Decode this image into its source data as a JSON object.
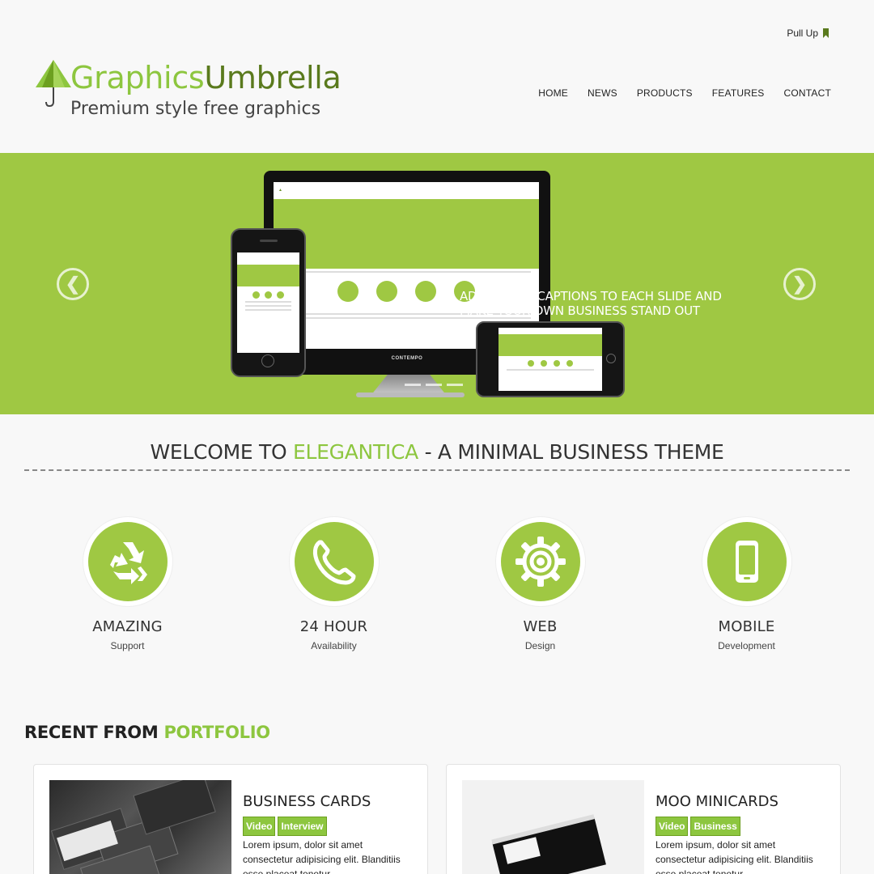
{
  "brand": {
    "name_part1": "Graphics",
    "name_part2": "Umbrella",
    "tagline": "Premium style free graphics"
  },
  "pull_up": {
    "label": "Pull Up"
  },
  "nav": {
    "items": [
      {
        "label": "HOME"
      },
      {
        "label": "NEWS"
      },
      {
        "label": "PRODUCTS"
      },
      {
        "label": "FEATURES"
      },
      {
        "label": "CONTACT"
      }
    ]
  },
  "hero": {
    "caption_line1": "ADD LOVELY CAPTIONS TO EACH SLIDE AND",
    "caption_line2": "MAKE YOUR OWN BUSINESS STAND OUT",
    "monitor_brand": "CONTEMPO"
  },
  "welcome": {
    "prefix": "WELCOME TO ",
    "accent": "ELEGANTICA",
    "suffix": " - A MINIMAL BUSINESS THEME"
  },
  "features": [
    {
      "title": "AMAZING",
      "subtitle": "Support",
      "icon": "recycle-icon"
    },
    {
      "title": "24 HOUR",
      "subtitle": "Availability",
      "icon": "phone-icon"
    },
    {
      "title": "WEB",
      "subtitle": "Design",
      "icon": "gear-icon"
    },
    {
      "title": "MOBILE",
      "subtitle": "Development",
      "icon": "mobile-icon"
    }
  ],
  "portfolio": {
    "heading_prefix": "RECENT FROM ",
    "heading_accent": "PORTFOLIO",
    "items": [
      {
        "title": "BUSINESS CARDS",
        "tags": [
          "Video",
          "Interview"
        ],
        "text": "Lorem ipsum, dolor sit amet consectetur adipisicing elit. Blanditiis esse placeat tenetur"
      },
      {
        "title": "MOO MINICARDS",
        "tags": [
          "Video",
          "Business"
        ],
        "text": "Lorem ipsum, dolor sit amet consectetur adipisicing elit. Blanditiis esse placeat tenetur"
      }
    ]
  },
  "colors": {
    "accent": "#8dc63f",
    "hero_bg": "#9fc843",
    "brand_dark": "#5a7a1d"
  }
}
